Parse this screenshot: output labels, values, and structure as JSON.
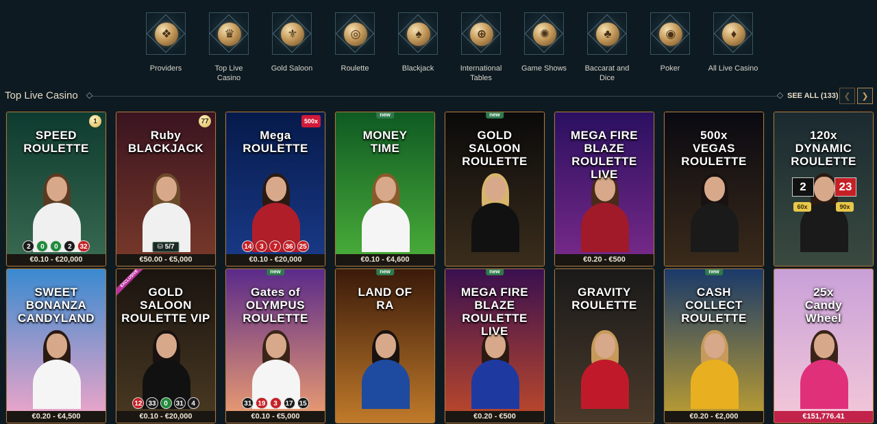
{
  "categories": [
    {
      "label": "Providers",
      "icon": "book-icon",
      "glyph": "❖"
    },
    {
      "label": "Top Live\nCasino",
      "icon": "crown-chip-icon",
      "glyph": "♛"
    },
    {
      "label": "Gold Saloon",
      "icon": "fleur-de-lis-icon",
      "glyph": "⚜"
    },
    {
      "label": "Roulette",
      "icon": "roulette-wheel-icon",
      "glyph": "◎"
    },
    {
      "label": "Blackjack",
      "icon": "cards-icon",
      "glyph": "♠"
    },
    {
      "label": "International\nTables",
      "icon": "globe-icon",
      "glyph": "⊕"
    },
    {
      "label": "Game Shows",
      "icon": "prize-wheel-icon",
      "glyph": "✺"
    },
    {
      "label": "Baccarat and\nDice",
      "icon": "cards-dice-icon",
      "glyph": "♣"
    },
    {
      "label": "Poker",
      "icon": "poker-chips-icon",
      "glyph": "◉"
    },
    {
      "label": "All Live Casino",
      "icon": "all-cards-icon",
      "glyph": "♦"
    }
  ],
  "section": {
    "title": "Top Live Casino",
    "see_all": "SEE ALL (133)",
    "prev_icon": "❮",
    "next_icon": "❯"
  },
  "games": [
    {
      "title": "SPEED\nROULETTE",
      "price": "€0.10 - €20,000",
      "badge": "1",
      "results": [
        [
          "2",
          "black"
        ],
        [
          "0",
          "green"
        ],
        [
          "0",
          "green"
        ],
        [
          "2",
          "black"
        ],
        [
          "32",
          "red"
        ]
      ],
      "colors": [
        "#0e3b2f",
        "#3a6b52"
      ],
      "hair": "#5a3a22",
      "outfit": "#f0f0f0"
    },
    {
      "title": "Ruby\nBLACKJACK",
      "price": "€50.00 - €5,000",
      "badge": "77",
      "seats": "⛁ 5/7",
      "colors": [
        "#3a1420",
        "#7a3a2a"
      ],
      "hair": "#6b4a2a",
      "outfit": "#f0f0f0"
    },
    {
      "title": "Mega\nROULETTE",
      "price": "€0.10 - €20,000",
      "tag": "500x",
      "results": [
        [
          "14",
          "red"
        ],
        [
          "3",
          "red"
        ],
        [
          "7",
          "red"
        ],
        [
          "36",
          "red"
        ],
        [
          "25",
          "red"
        ]
      ],
      "colors": [
        "#061a4a",
        "#1a3b8a"
      ],
      "hair": "#2a1a12",
      "outfit": "#b01e2a"
    },
    {
      "title": "MONEY\nTIME",
      "price": "€0.10 - €4,600",
      "new": "new",
      "colors": [
        "#0f5a23",
        "#4cb03a"
      ],
      "hair": "#8a5a2a",
      "outfit": "#f5f5f5"
    },
    {
      "title": "GOLD SALOON\nROULETTE",
      "price": "",
      "new": "new",
      "colors": [
        "#0a0a0a",
        "#3a2d1c"
      ],
      "hair": "#d8b56c",
      "outfit": "#111"
    },
    {
      "title": "MEGA FIRE BLAZE\nROULETTE LIVE",
      "price": "€0.20 - €500",
      "colors": [
        "#2a1060",
        "#7a2a8a"
      ],
      "hair": "#4a2a1a",
      "outfit": "#a01a2a"
    },
    {
      "title": "500x\nVEGAS\nROULETTE",
      "price": "",
      "colors": [
        "#0a0a12",
        "#3a2a1a"
      ],
      "hair": "#1a1210",
      "outfit": "#1a1a1a"
    },
    {
      "title": "120x\nDYNAMIC\nROULETTE",
      "price": "",
      "dynamic": {
        "left": "2",
        "right": "23",
        "m1": "60x",
        "m2": "90x"
      },
      "colors": [
        "#1a2a30",
        "#3a4a40"
      ],
      "hair": "#2a1a12",
      "outfit": "#1a1a1a"
    },
    {
      "title": "SWEET\nBONANZA\nCANDYLAND",
      "price": "€0.20 - €4,500",
      "colors": [
        "#3a8ad0",
        "#f4a6c8"
      ],
      "hair": "#2a1a12",
      "outfit": "#f5f5f5"
    },
    {
      "title": "GOLD SALOON\nROULETTE VIP",
      "price": "€0.10 - €20,000",
      "exclusive": "EXCLUSIVE",
      "results": [
        [
          "12",
          "red"
        ],
        [
          "33",
          "black"
        ],
        [
          "0",
          "green"
        ],
        [
          "31",
          "black"
        ],
        [
          "4",
          "black"
        ]
      ],
      "colors": [
        "#1a1410",
        "#4a3a22"
      ],
      "hair": "#1a1210",
      "outfit": "#111"
    },
    {
      "title": "Gates of\nOLYMPUS\nROULETTE",
      "price": "€0.10 - €5,000",
      "new": "new",
      "results": [
        [
          "31",
          "black"
        ],
        [
          "19",
          "red"
        ],
        [
          "3",
          "red"
        ],
        [
          "17",
          "black"
        ],
        [
          "15",
          "black"
        ]
      ],
      "colors": [
        "#5a2a8a",
        "#f0a070"
      ],
      "hair": "#3a2418",
      "outfit": "#f5f5f5"
    },
    {
      "title": "LAND OF\nRA",
      "price": "",
      "new": "new",
      "colors": [
        "#3a1a0a",
        "#c07a2a"
      ],
      "hair": "#1a1210",
      "outfit": "#1e4aa0"
    },
    {
      "title": "MEGA FIRE BLAZE\nROULETTE LIVE",
      "price": "€0.20 - €500",
      "new": "new",
      "colors": [
        "#3a1050",
        "#c04a2a"
      ],
      "hair": "#2a1a12",
      "outfit": "#1e3aa0"
    },
    {
      "title": "GRAVITY\nROULETTE",
      "price": "",
      "colors": [
        "#1a1a1a",
        "#4a3a2a"
      ],
      "hair": "#c89a5a",
      "outfit": "#c01a2a"
    },
    {
      "title": "CASH\nCOLLECT\nROULETTE",
      "price": "€0.20 - €2,000",
      "new": "new",
      "colors": [
        "#1a3a6a",
        "#c0a030"
      ],
      "hair": "#c89a5a",
      "outfit": "#e8b020"
    },
    {
      "title": "25x\nCandy\nWheel",
      "price": "€151,776.41",
      "jackpot": true,
      "colors": [
        "#c8a0d8",
        "#f4c8d8"
      ],
      "hair": "#3a2418",
      "outfit": "#e0307a"
    }
  ]
}
